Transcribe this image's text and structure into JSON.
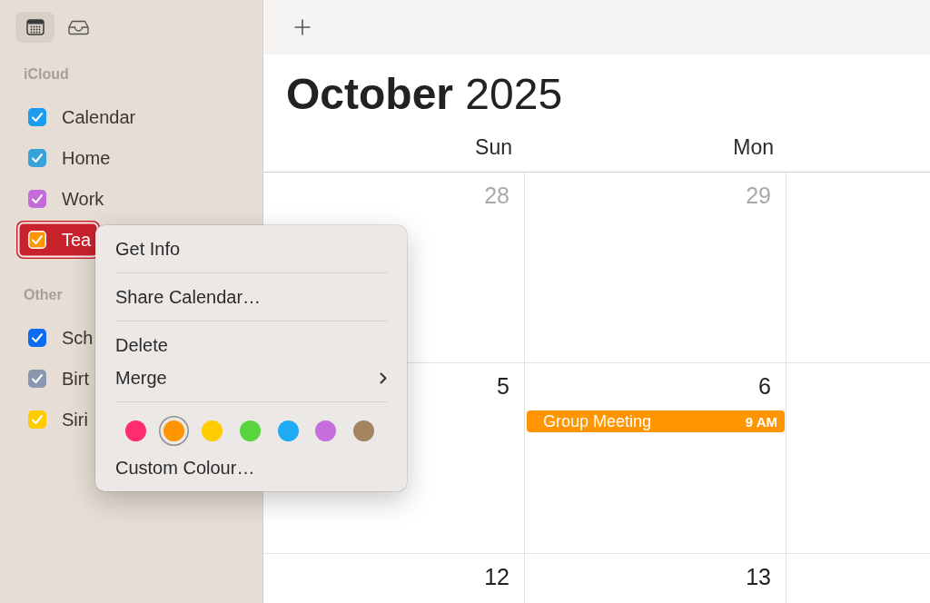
{
  "sidebar": {
    "view_buttons": [
      {
        "kind": "calendar",
        "selected": true
      },
      {
        "kind": "inbox",
        "selected": false
      }
    ],
    "groups": [
      {
        "title": "iCloud",
        "calendars": [
          {
            "name": "Calendar",
            "checked": true,
            "selected": false,
            "color": "#1a9cf0"
          },
          {
            "name": "Home",
            "checked": true,
            "selected": false,
            "color": "#38a3d9"
          },
          {
            "name": "Work",
            "checked": true,
            "selected": false,
            "color": "#c46bd9"
          },
          {
            "name": "Tea",
            "checked": true,
            "selected": true,
            "color": "#ff9500"
          }
        ]
      },
      {
        "title": "Other",
        "calendars": [
          {
            "name": "Sch",
            "checked": true,
            "selected": false,
            "color": "#0b6cf2"
          },
          {
            "name": "Birt",
            "checked": true,
            "selected": false,
            "color": "#8a97b0"
          },
          {
            "name": "Siri",
            "checked": true,
            "selected": false,
            "color": "#ffcc00"
          }
        ]
      }
    ]
  },
  "calendar": {
    "title": "**October** 2025",
    "weekdays": [
      "Sun",
      "Mon"
    ],
    "weeks": [
      {
        "days": [
          {
            "date": "28",
            "current_month": false
          },
          {
            "date": "29",
            "current_month": false
          }
        ]
      },
      {
        "days": [
          {
            "date": "5",
            "current_month": true
          },
          {
            "date": "6",
            "current_month": true,
            "events": [
              {
                "title": "Group Meeting",
                "time": "9 AM",
                "color": "#ff9500"
              }
            ]
          }
        ]
      },
      {
        "days": [
          {
            "date": "12",
            "current_month": true
          },
          {
            "date": "13",
            "current_month": true
          }
        ]
      }
    ]
  },
  "context_menu": {
    "sections": [
      {
        "items": [
          {
            "label": "Get Info",
            "submenu": false
          }
        ]
      },
      {
        "items": [
          {
            "label": "Share Calendar…",
            "submenu": false
          }
        ]
      },
      {
        "items": [
          {
            "label": "Delete",
            "submenu": false
          },
          {
            "label": "Merge",
            "submenu": true
          }
        ]
      },
      {
        "swatches": [
          {
            "color": "#ff2d6e",
            "selected": false
          },
          {
            "color": "#ff9500",
            "selected": true
          },
          {
            "color": "#ffcc00",
            "selected": false
          },
          {
            "color": "#5ad43e",
            "selected": false
          },
          {
            "color": "#1eaaf5",
            "selected": false
          },
          {
            "color": "#c56fdc",
            "selected": false
          },
          {
            "color": "#a2845e",
            "selected": false
          }
        ],
        "items": [
          {
            "label": "Custom Colour…",
            "submenu": false
          }
        ]
      }
    ]
  }
}
